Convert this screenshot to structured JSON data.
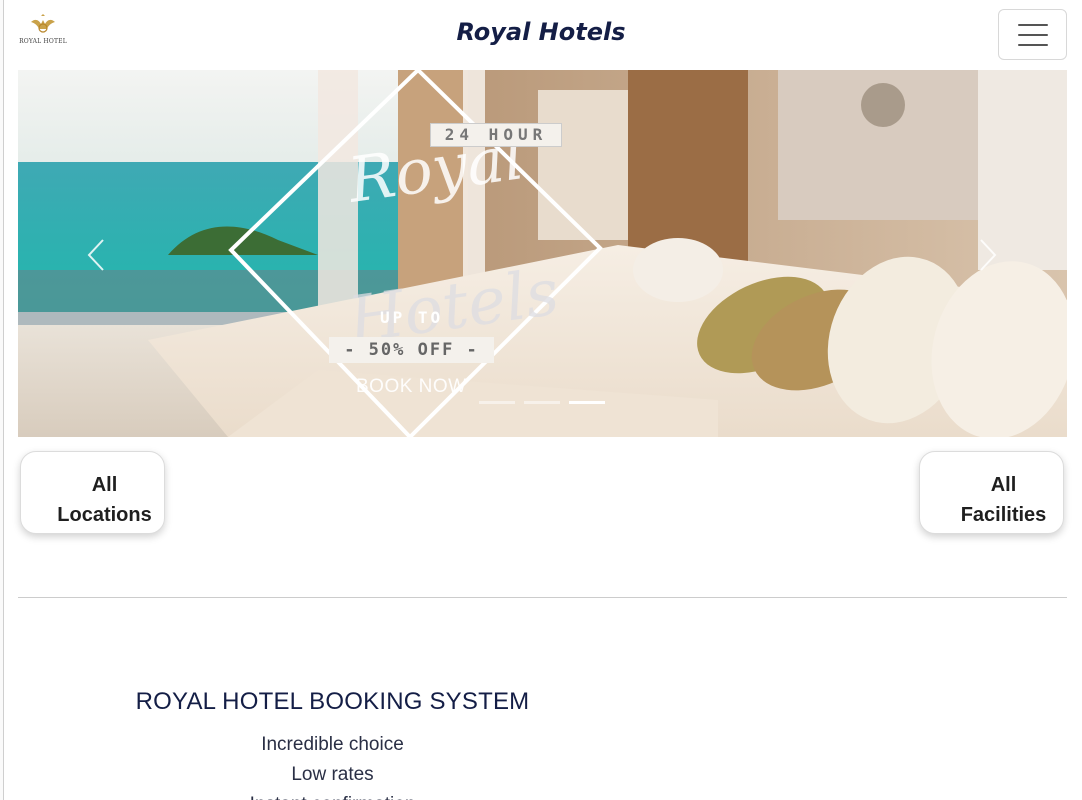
{
  "navbar": {
    "logo_text": "ROYAL HOTEL",
    "brand_title": "Royal Hotels",
    "menu_icon": "hamburger-icon"
  },
  "carousel": {
    "promo": {
      "hour_tag": "24 HOUR",
      "script_top": "Royal",
      "script_bottom": "Hotels",
      "up_to": "UP TO",
      "discount": "- 50% OFF -",
      "cta": "BOOK NOW"
    },
    "prev_icon": "chevron-left-icon",
    "next_icon": "chevron-right-icon",
    "slide_count": 3,
    "active_slide": 3
  },
  "filters": {
    "locations": {
      "line1": "All",
      "line2": "Locations"
    },
    "facilities": {
      "line1": "All",
      "line2": "Facilities"
    }
  },
  "about": {
    "heading": "ROYAL HOTEL BOOKING SYSTEM",
    "features": [
      "Incredible choice",
      "Low rates",
      "Instant confirmation"
    ]
  },
  "colors": {
    "brand": "#141e46",
    "sea": "#2fb5b0",
    "linen": "#f1e6da"
  }
}
